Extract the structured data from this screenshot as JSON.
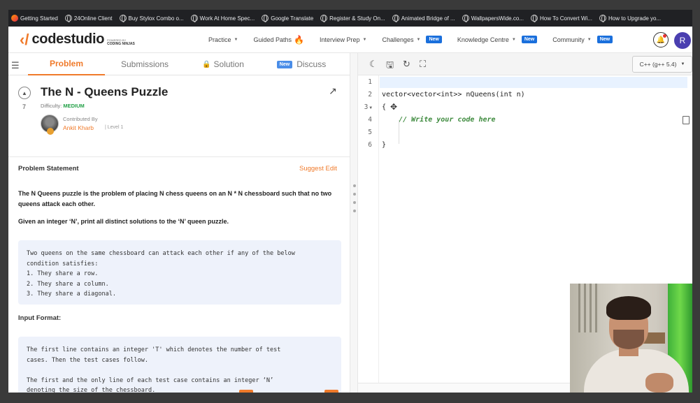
{
  "bookmarks": [
    {
      "label": "Getting Started",
      "icon": "firefox-icon"
    },
    {
      "label": "24Online Client",
      "icon": "globe-icon"
    },
    {
      "label": "Buy Stylox Combo o...",
      "icon": "globe-icon"
    },
    {
      "label": "Work At Home Spec...",
      "icon": "globe-icon"
    },
    {
      "label": "Google Translate",
      "icon": "globe-icon"
    },
    {
      "label": "Register & Study On...",
      "icon": "globe-icon"
    },
    {
      "label": "Animated Bridge of ...",
      "icon": "globe-icon"
    },
    {
      "label": "WallpapersWide.co...",
      "icon": "globe-icon"
    },
    {
      "label": "How To Convert Wi...",
      "icon": "globe-icon"
    },
    {
      "label": "How to Upgrade yo...",
      "icon": "globe-icon"
    }
  ],
  "header": {
    "logo_text": "codestudio",
    "powered_by": "POWERED BY",
    "brand": "CODING NINJAS",
    "nav": [
      {
        "label": "Practice",
        "has_caret": true
      },
      {
        "label": "Guided Paths",
        "has_caret": false,
        "flame": true
      },
      {
        "label": "Interview Prep",
        "has_caret": true
      },
      {
        "label": "Challenges",
        "has_caret": true,
        "badge": "New"
      },
      {
        "label": "Knowledge Centre",
        "has_caret": true,
        "badge": "New"
      },
      {
        "label": "Community",
        "has_caret": true,
        "badge": "New"
      }
    ],
    "avatar_initial": "R"
  },
  "tabs": {
    "problem": "Problem",
    "submissions": "Submissions",
    "solution": "Solution",
    "discuss_badge": "New",
    "discuss": "Discuss"
  },
  "problem": {
    "votes": "7",
    "title": "The N - Queens Puzzle",
    "difficulty_label": "Difficulty:",
    "difficulty": "MEDIUM",
    "contributed_label": "Contributed By",
    "author": "Ankit Kharb",
    "level": "Level 1",
    "statement_label": "Problem Statement",
    "suggest_edit": "Suggest Edit",
    "para1": "The N Queens puzzle is the problem of placing N chess queens on an N * N chessboard such that no two queens attack each other.",
    "para2": "Given an integer ‘N’, print all distinct solutions to the ‘N’ queen puzzle.",
    "box1": "Two queens on the same chessboard can attack each other if any of the below\ncondition satisfies:\n1. They share a row.\n2. They share a column.\n3. They share a diagonal.",
    "input_format_label": "Input Format:",
    "box2": "The first line contains an integer 'T' which denotes the number of test\ncases. Then the test cases follow.\n\nThe first and the only line of each test case contains an integer ‘N’\ndenoting the size of the chessboard."
  },
  "editor": {
    "language": "C++ (g++ 5.4)",
    "lines": [
      {
        "num": "1",
        "text": ""
      },
      {
        "num": "2",
        "text": "vector<vector<int>> nQueens(int n)"
      },
      {
        "num": "3",
        "text": "{"
      },
      {
        "num": "4",
        "text": "    // Write your code here"
      },
      {
        "num": "5",
        "text": ""
      },
      {
        "num": "6",
        "text": "}"
      }
    ]
  },
  "colors": {
    "accent": "#f07a2a",
    "medium": "#24a148",
    "new_badge": "#1a6fdc",
    "comment": "#3d8a3d"
  }
}
